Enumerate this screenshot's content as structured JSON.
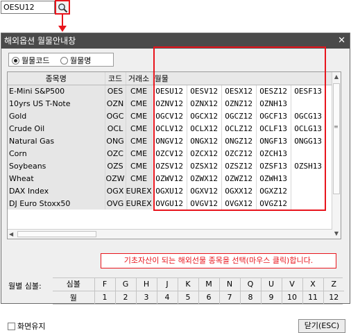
{
  "top": {
    "input_value": "OESU12"
  },
  "window": {
    "title": "해외옵션 월물안내창",
    "close_glyph": "✕"
  },
  "radios": [
    {
      "label": "월물코드",
      "selected": true
    },
    {
      "label": "월물명",
      "selected": false
    }
  ],
  "grid": {
    "headers": {
      "name": "종목명",
      "code": "코드",
      "exchange": "거래소",
      "months": "월물"
    },
    "rows": [
      {
        "name": "E-Mini S&P500",
        "code": "OES",
        "exchange": "CME",
        "symbols": [
          "OESU12",
          "OESV12",
          "OESX12",
          "OESZ12",
          "OESF13"
        ]
      },
      {
        "name": "10yrs US T-Note",
        "code": "OZN",
        "exchange": "CME",
        "symbols": [
          "OZNV12",
          "OZNX12",
          "OZNZ12",
          "OZNH13",
          ""
        ]
      },
      {
        "name": "Gold",
        "code": "OGC",
        "exchange": "CME",
        "symbols": [
          "OGCV12",
          "OGCX12",
          "OGCZ12",
          "OGCF13",
          "OGCG13"
        ]
      },
      {
        "name": "Crude Oil",
        "code": "OCL",
        "exchange": "CME",
        "symbols": [
          "OCLV12",
          "OCLX12",
          "OCLZ12",
          "OCLF13",
          "OCLG13"
        ]
      },
      {
        "name": "Natural Gas",
        "code": "ONG",
        "exchange": "CME",
        "symbols": [
          "ONGV12",
          "ONGX12",
          "ONGZ12",
          "ONGF13",
          "ONGG13"
        ]
      },
      {
        "name": "Corn",
        "code": "OZC",
        "exchange": "CME",
        "symbols": [
          "OZCV12",
          "OZCX12",
          "OZCZ12",
          "OZCH13",
          ""
        ]
      },
      {
        "name": "Soybeans",
        "code": "OZS",
        "exchange": "CME",
        "symbols": [
          "OZSV12",
          "OZSX12",
          "OZSZ12",
          "OZSF13",
          "OZSH13"
        ]
      },
      {
        "name": "Wheat",
        "code": "OZW",
        "exchange": "CME",
        "symbols": [
          "OZWV12",
          "OZWX12",
          "OZWZ12",
          "OZWH13",
          ""
        ]
      },
      {
        "name": "DAX Index",
        "code": "OGX",
        "exchange": "EUREX",
        "symbols": [
          "OGXU12",
          "OGXV12",
          "OGXX12",
          "OGXZ12",
          ""
        ]
      },
      {
        "name": "DJ Euro Stoxx50",
        "code": "OVG",
        "exchange": "EUREX",
        "symbols": [
          "OVGU12",
          "OVGV12",
          "OVGX12",
          "OVGZ12",
          ""
        ]
      }
    ]
  },
  "callout": "기초자산이 되는 해외선물 종목을 선택(마우스 클릭)합니다.",
  "month_table": {
    "label": "월별 심볼:",
    "symbol_header": "심볼",
    "month_header": "월",
    "symbols": [
      "F",
      "G",
      "H",
      "J",
      "K",
      "M",
      "N",
      "Q",
      "U",
      "V",
      "X",
      "Z"
    ],
    "months": [
      "1",
      "2",
      "3",
      "4",
      "5",
      "6",
      "7",
      "8",
      "9",
      "10",
      "11",
      "12"
    ]
  },
  "footer": {
    "keep_label": "화면유지",
    "close_label": "닫기(ESC)"
  },
  "colors": {
    "accent_red": "#e8141c",
    "titlebar": "#4a4a4a"
  }
}
